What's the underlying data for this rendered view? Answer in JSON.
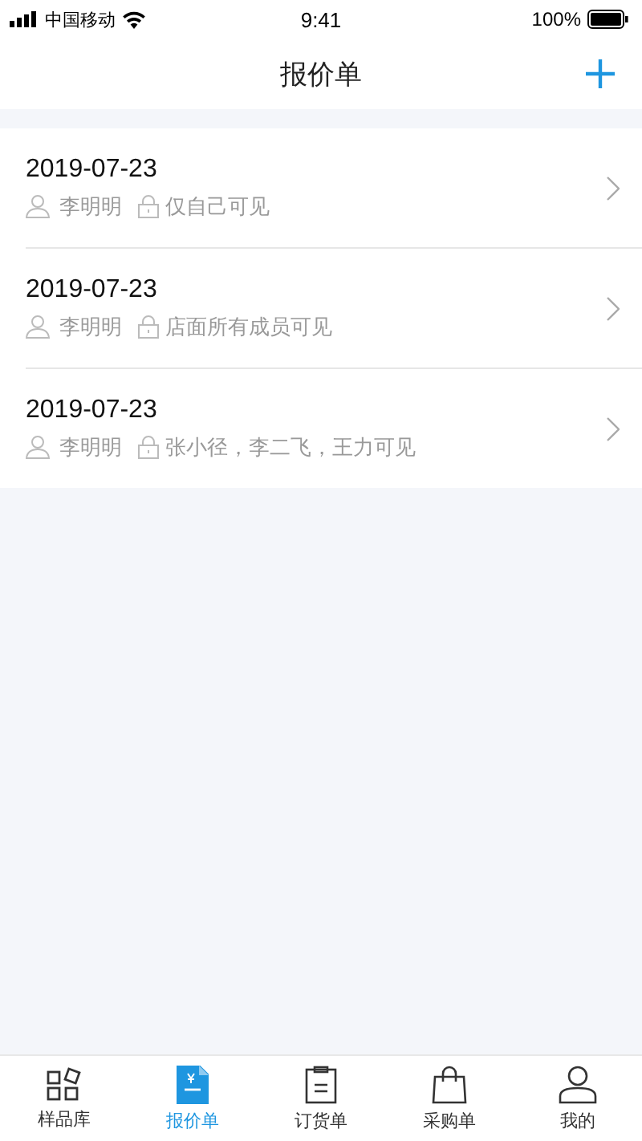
{
  "status_bar": {
    "carrier": "中国移动",
    "time": "9:41",
    "battery": "100%"
  },
  "header": {
    "title": "报价单"
  },
  "quotes": [
    {
      "date": "2019-07-23",
      "owner": "李明明",
      "visibility": "仅自己可见"
    },
    {
      "date": "2019-07-23",
      "owner": "李明明",
      "visibility": "店面所有成员可见"
    },
    {
      "date": "2019-07-23",
      "owner": "李明明",
      "visibility": "张小径，李二飞，王力可见"
    }
  ],
  "tabs": [
    {
      "label": "样品库",
      "selected": false
    },
    {
      "label": "报价单",
      "selected": true
    },
    {
      "label": "订货单",
      "selected": false
    },
    {
      "label": "采购单",
      "selected": false
    },
    {
      "label": "我的",
      "selected": false
    }
  ]
}
